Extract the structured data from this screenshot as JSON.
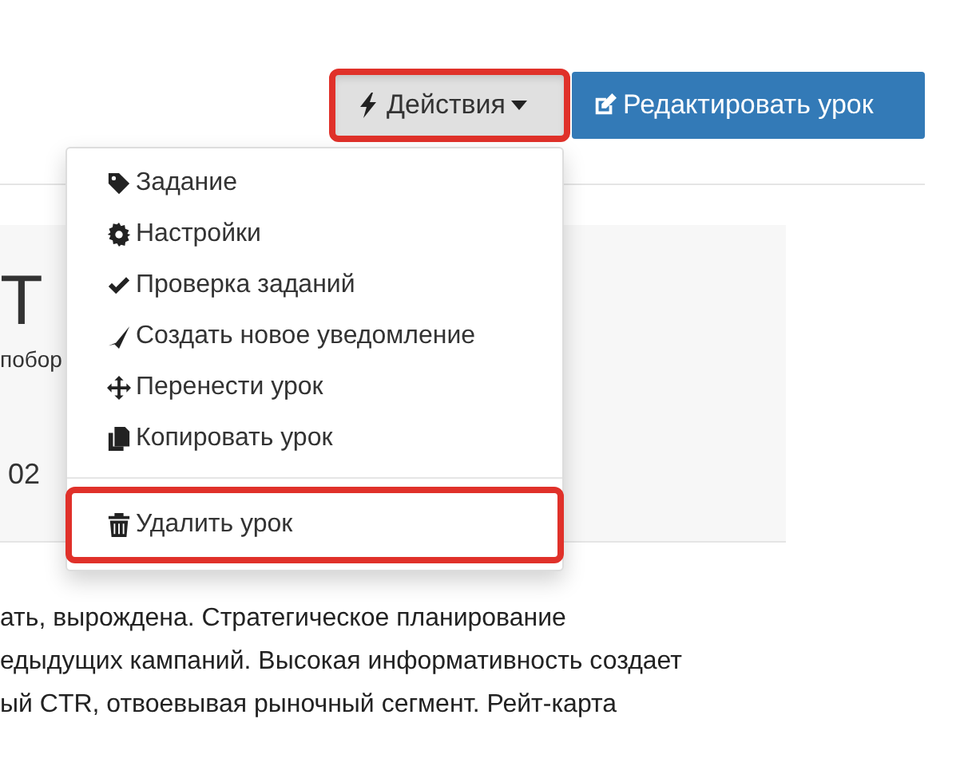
{
  "toolbar": {
    "actions_button": {
      "label": "Действия",
      "expanded": true,
      "highlighted": true
    },
    "edit_button": {
      "label": "Редактировать урок"
    }
  },
  "lesson_header": {
    "title": "Т",
    "subtitle": "побор",
    "date": "02"
  },
  "actions_menu": [
    {
      "label": "Задание",
      "highlighted": false
    },
    {
      "label": "Настройки",
      "highlighted": false
    },
    {
      "label": "Проверка заданий",
      "highlighted": false
    },
    {
      "label": "Создать новое уведомление",
      "highlighted": false
    },
    {
      "label": "Перенести урок",
      "highlighted": false
    },
    {
      "label": "Копировать урок",
      "highlighted": false
    },
    {
      "label": "Удалить урок",
      "divider_before": true,
      "highlighted": true
    }
  ],
  "description_lines": [
    "ать, вырождена. Стратегическое планирование",
    "едыдущих кампаний. Высокая информативность создает",
    "ый CTR, отвоевывая рыночный сегмент. Рейт-карта"
  ]
}
